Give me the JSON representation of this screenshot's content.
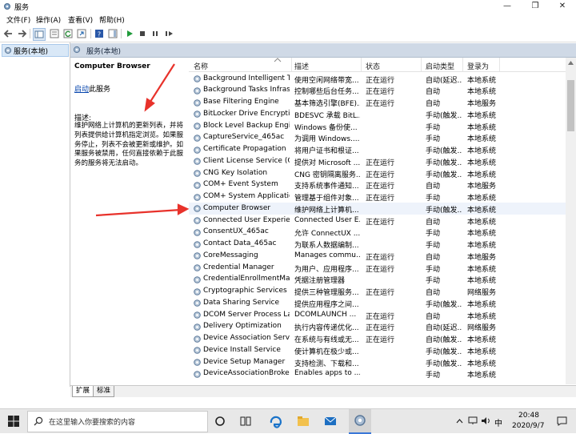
{
  "window": {
    "title": "服务",
    "controls": {
      "minimize": "—",
      "maximize": "❐",
      "close": "✕"
    }
  },
  "menu": [
    "文件(F)",
    "操作(A)",
    "查看(V)",
    "帮助(H)"
  ],
  "tree": {
    "item": "服务(本地)"
  },
  "banner": {
    "title": "服务(本地)"
  },
  "details": {
    "title": "Computer Browser",
    "start_link": "启动",
    "start_suffix": "此服务",
    "desc_label": "描述:",
    "desc_text": "维护网络上计算机的更新列表，并将列表提供给计算机指定浏览。如果服务停止，列表不会被更新或维护。如果服务被禁用，任何直接依赖于此服务的服务将无法启动。"
  },
  "columns": [
    "名称",
    "描述",
    "状态",
    "启动类型",
    "登录为"
  ],
  "services": [
    [
      "Background Intelligent T...",
      "使用空闲网络带宽...",
      "正在运行",
      "自动(延迟...",
      "本地系统"
    ],
    [
      "Background Tasks Infras...",
      "控制哪些后台任务...",
      "正在运行",
      "自动",
      "本地系统"
    ],
    [
      "Base Filtering Engine",
      "基本筛选引擎(BFE)...",
      "正在运行",
      "自动",
      "本地服务"
    ],
    [
      "BitLocker Drive Encryptio...",
      "BDESVC 承载 BitL...",
      "",
      "手动(触发...",
      "本地系统"
    ],
    [
      "Block Level Backup Engi...",
      "Windows 备份使...",
      "",
      "手动",
      "本地系统"
    ],
    [
      "CaptureService_465ac",
      "为调用 Windows....",
      "",
      "手动",
      "本地系统"
    ],
    [
      "Certificate Propagation",
      "将用户证书和根证...",
      "",
      "手动(触发...",
      "本地系统"
    ],
    [
      "Client License Service (Cli...",
      "提供对 Microsoft ...",
      "正在运行",
      "手动(触发...",
      "本地系统"
    ],
    [
      "CNG Key Isolation",
      "CNG 密钥隔离服务...",
      "正在运行",
      "手动(触发...",
      "本地系统"
    ],
    [
      "COM+ Event System",
      "支持系统事件通知...",
      "正在运行",
      "自动",
      "本地服务"
    ],
    [
      "COM+ System Application",
      "管理基于组件对象...",
      "正在运行",
      "手动",
      "本地系统"
    ],
    [
      "Computer Browser",
      "维护网络上计算机...",
      "",
      "手动(触发...",
      "本地系统"
    ],
    [
      "Connected User Experien...",
      "Connected User E...",
      "正在运行",
      "自动",
      "本地系统"
    ],
    [
      "ConsentUX_465ac",
      "允许 ConnectUX ...",
      "",
      "手动",
      "本地系统"
    ],
    [
      "Contact Data_465ac",
      "为联系人数据编制...",
      "",
      "手动",
      "本地系统"
    ],
    [
      "CoreMessaging",
      "Manages commu...",
      "正在运行",
      "自动",
      "本地服务"
    ],
    [
      "Credential Manager",
      "为用户、应用程序...",
      "正在运行",
      "手动",
      "本地系统"
    ],
    [
      "CredentialEnrollmentMan...",
      "凭据注册管理器",
      "",
      "手动",
      "本地系统"
    ],
    [
      "Cryptographic Services",
      "提供三种管理服务...",
      "正在运行",
      "自动",
      "网络服务"
    ],
    [
      "Data Sharing Service",
      "提供应用程序之间...",
      "",
      "手动(触发...",
      "本地系统"
    ],
    [
      "DCOM Server Process La...",
      "DCOMLAUNCH ...",
      "正在运行",
      "自动",
      "本地系统"
    ],
    [
      "Delivery Optimization",
      "执行内容传递优化...",
      "正在运行",
      "自动(延迟...",
      "网络服务"
    ],
    [
      "Device Association Service",
      "在系统与有线或无...",
      "正在运行",
      "自动(触发...",
      "本地系统"
    ],
    [
      "Device Install Service",
      "使计算机在极少或...",
      "",
      "手动(触发...",
      "本地系统"
    ],
    [
      "Device Setup Manager",
      "支持检测、下载和...",
      "",
      "手动(触发...",
      "本地系统"
    ],
    [
      "DeviceAssociationBroker...",
      "Enables apps to ...",
      "",
      "手动",
      "本地系统"
    ]
  ],
  "tabs": [
    "扩展",
    "标准"
  ],
  "taskbar": {
    "search_placeholder": "在这里输入你要搜索的内容",
    "ime": "中",
    "time": "20:48",
    "date": "2020/9/7"
  },
  "colors": {
    "accent_arrow": "#e8322b",
    "selection": "#eef3fb",
    "banner": "#cfd9e6"
  }
}
